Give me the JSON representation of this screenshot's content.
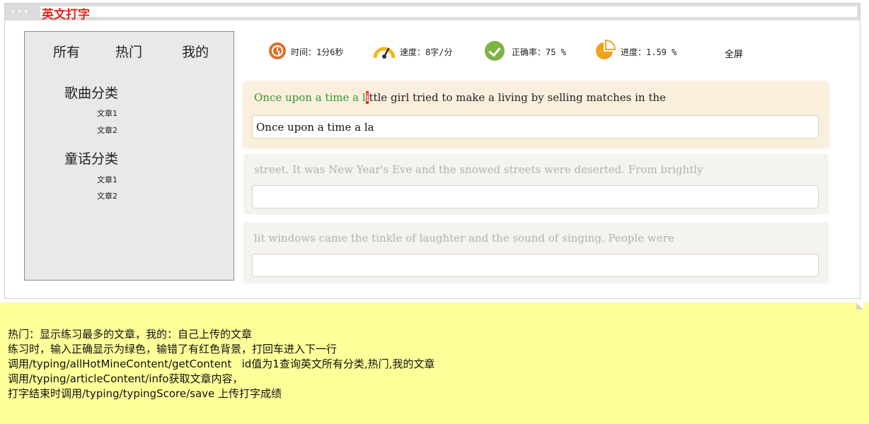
{
  "app": {
    "title": "英文打字",
    "dots": "•••"
  },
  "sidebar": {
    "tabs": [
      {
        "label": "所有"
      },
      {
        "label": "热门"
      },
      {
        "label": "我的"
      }
    ],
    "categories": [
      {
        "title": "歌曲分类",
        "items": [
          "文章1",
          "文章2"
        ]
      },
      {
        "title": "童话分类",
        "items": [
          "文章1",
          "文章2"
        ]
      }
    ]
  },
  "stats": {
    "time": "时间：1分6秒",
    "speed": "速度：8字/分",
    "accuracy": "正确率：75 %",
    "progress": "进度：1.59 %",
    "progress_value": 0.0159,
    "fullscreen": "全屏"
  },
  "lines": [
    {
      "correct": "Once upon a time a l",
      "error": "i",
      "rest": "ttle girl tried to make a living by selling matches in the",
      "input": "Once upon a time a la"
    },
    {
      "text": "street. It was New Year's Eve and the snowed streets were deserted. From brightly",
      "input": ""
    },
    {
      "text": "lit windows came the tinkle of laughter and the sound of singing. People were",
      "input": ""
    }
  ],
  "colors": {
    "correct": "#2f9a2f",
    "error": "#ef2e26",
    "accent_orange": "#e0702a",
    "check_green": "#7cb442",
    "note_background": "#ffff99"
  },
  "note": {
    "lines": [
      "热门：显示练习最多的文章，我的：自己上传的文章",
      "练习时，输入正确显示为绿色，输错了有红色背景，打回车进入下一行",
      "调用/typing/allHotMineContent/getContent   id值为1查询英文所有分类,热门,我的文章",
      "调用/typing/articleContent/info获取文章内容，",
      "打字结束时调用/typing/typingScore/save 上传打字成绩"
    ]
  }
}
